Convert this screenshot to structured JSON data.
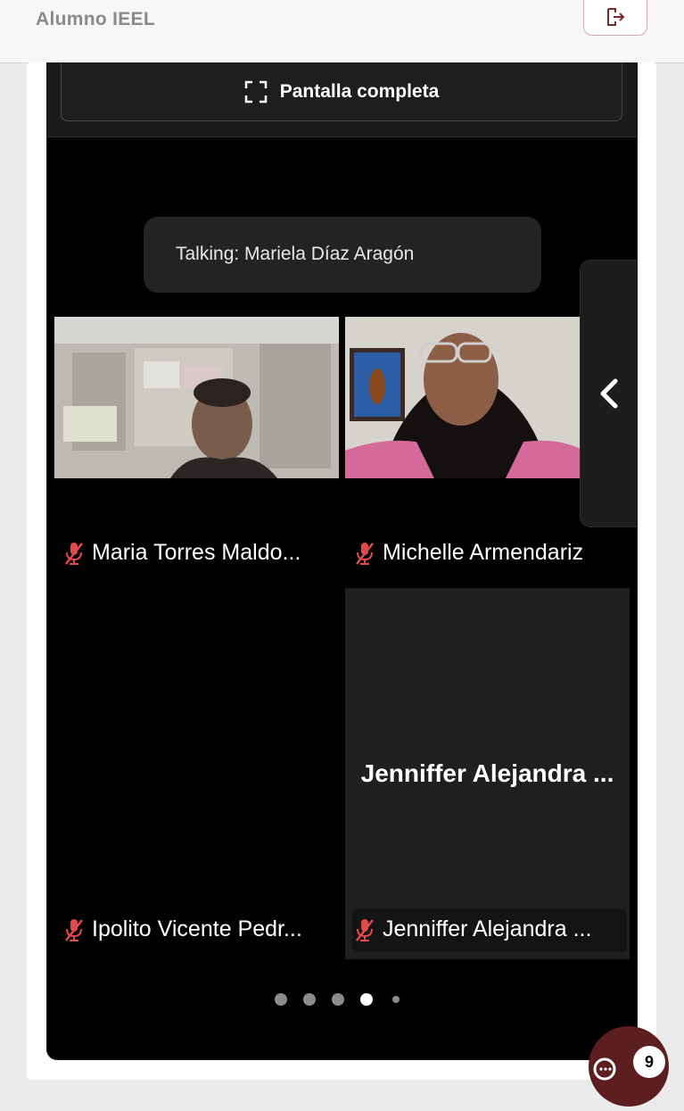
{
  "header": {
    "user_role": "Alumno IEEL",
    "logout_icon": "logout-icon"
  },
  "player": {
    "fullscreen_label": "Pantalla completa",
    "fullscreen_icon": "fullscreen-icon",
    "talking_text": "Talking: Mariela Díaz Aragón",
    "side_toggle_icon": "chevron-left-icon",
    "participants": [
      {
        "name": "Maria Torres Maldo...",
        "muted": true,
        "video": true
      },
      {
        "name": "Michelle Armendariz",
        "muted": true,
        "video": true
      },
      {
        "name": "Ipolito Vicente Pedr...",
        "muted": true,
        "video": false
      },
      {
        "name": "Jenniffer Alejandra ...",
        "muted": true,
        "video": false,
        "avatar_name": "Jenniffer Alejandra ..."
      }
    ],
    "pagination": {
      "pages": 5,
      "current": 4
    }
  },
  "fab": {
    "badge_count": "9"
  },
  "colors": {
    "accent": "#5c1e1e",
    "muted_icon": "#e04a4a",
    "background": "#000000"
  }
}
